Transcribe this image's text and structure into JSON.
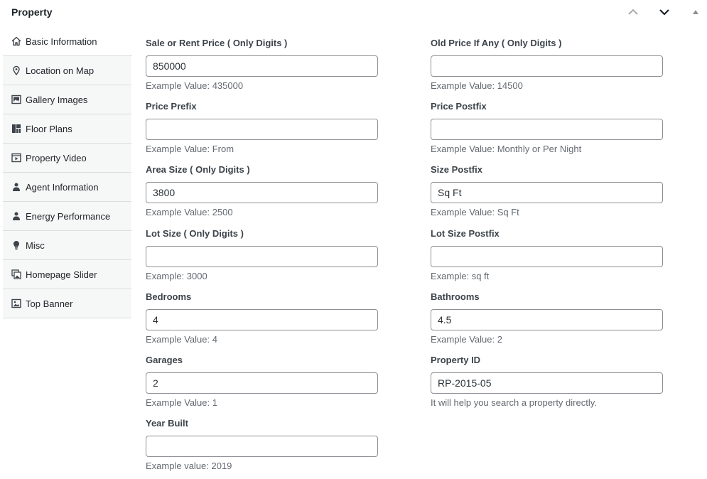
{
  "panel": {
    "title": "Property",
    "move_up_icon": "chevron-up-icon",
    "move_down_icon": "chevron-down-icon",
    "toggle_icon": "triangle-up-icon"
  },
  "tabs": [
    {
      "label": "Basic Information",
      "icon": "home-icon",
      "active": true
    },
    {
      "label": "Location on Map",
      "icon": "location-pin-icon",
      "active": false
    },
    {
      "label": "Gallery Images",
      "icon": "images-icon",
      "active": false
    },
    {
      "label": "Floor Plans",
      "icon": "floor-plan-icon",
      "active": false
    },
    {
      "label": "Property Video",
      "icon": "video-icon",
      "active": false
    },
    {
      "label": "Agent Information",
      "icon": "person-icon",
      "active": false
    },
    {
      "label": "Energy Performance",
      "icon": "person-icon",
      "active": false
    },
    {
      "label": "Misc",
      "icon": "lightbulb-icon",
      "active": false
    },
    {
      "label": "Homepage Slider",
      "icon": "slides-icon",
      "active": false
    },
    {
      "label": "Top Banner",
      "icon": "image-icon",
      "active": false
    }
  ],
  "fields": {
    "price": {
      "label": "Sale or Rent Price ( Only Digits )",
      "value": "850000",
      "desc": "Example Value: 435000"
    },
    "old_price": {
      "label": "Old Price If Any ( Only Digits )",
      "value": "",
      "desc": "Example Value: 14500"
    },
    "price_prefix": {
      "label": "Price Prefix",
      "value": "",
      "desc": "Example Value: From"
    },
    "price_postfix": {
      "label": "Price Postfix",
      "value": "",
      "desc": "Example Value: Monthly or Per Night"
    },
    "area_size": {
      "label": "Area Size ( Only Digits )",
      "value": "3800",
      "desc": "Example Value: 2500"
    },
    "size_postfix": {
      "label": "Size Postfix",
      "value": "Sq Ft",
      "desc": "Example Value: Sq Ft"
    },
    "lot_size": {
      "label": "Lot Size ( Only Digits )",
      "value": "",
      "desc": "Example: 3000"
    },
    "lot_size_postfix": {
      "label": "Lot Size Postfix",
      "value": "",
      "desc": "Example: sq ft"
    },
    "bedrooms": {
      "label": "Bedrooms",
      "value": "4",
      "desc": "Example Value: 4"
    },
    "bathrooms": {
      "label": "Bathrooms",
      "value": "4.5",
      "desc": "Example Value: 2"
    },
    "garages": {
      "label": "Garages",
      "value": "2",
      "desc": "Example Value: 1"
    },
    "property_id": {
      "label": "Property ID",
      "value": "RP-2015-05",
      "desc": "It will help you search a property directly."
    },
    "year_built": {
      "label": "Year Built",
      "value": "",
      "desc": "Example value: 2019"
    }
  }
}
